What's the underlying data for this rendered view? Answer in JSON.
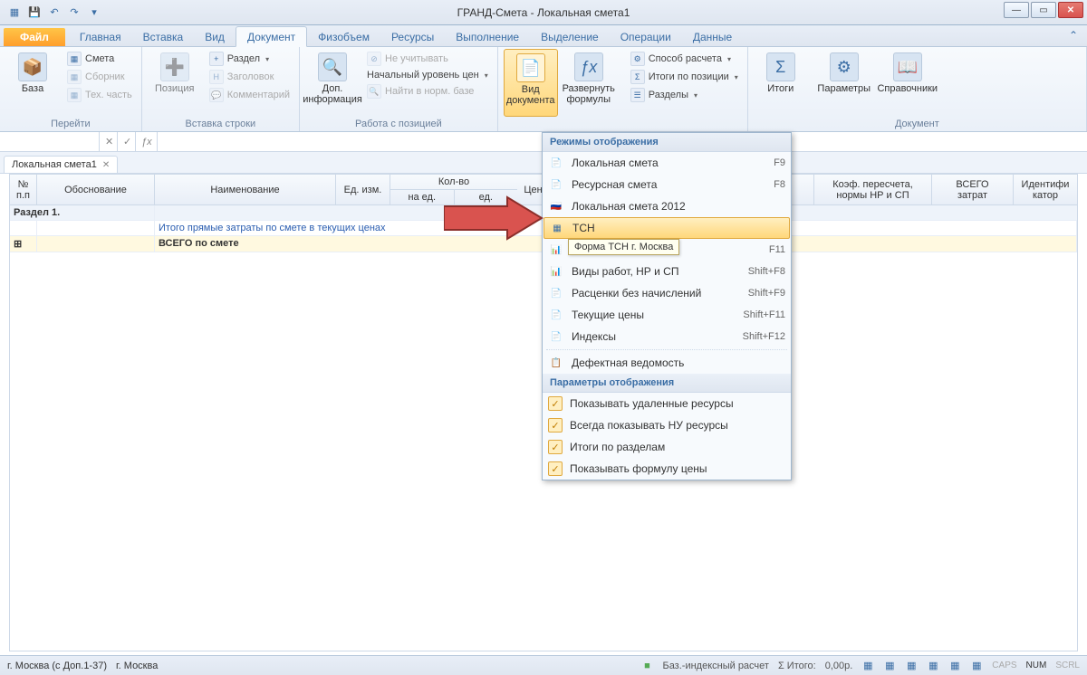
{
  "title": "ГРАНД-Смета - Локальная смета1",
  "qat_icons": [
    "grid-icon",
    "save-icon",
    "undo-icon",
    "redo-icon",
    "dropdown-icon"
  ],
  "tabs": {
    "file": "Файл",
    "items": [
      "Главная",
      "Вставка",
      "Вид",
      "Документ",
      "Физобъем",
      "Ресурсы",
      "Выполнение",
      "Выделение",
      "Операции",
      "Данные"
    ],
    "active": "Документ"
  },
  "ribbon": {
    "g1": {
      "label": "Перейти",
      "big": {
        "label": "База",
        "icon": "📦"
      },
      "items": [
        "Смета",
        "Сборник",
        "Тех. часть"
      ]
    },
    "g2": {
      "label": "Вставка строки",
      "big": {
        "label": "Позиция",
        "icon": "➕"
      },
      "items": [
        "Раздел",
        "Заголовок",
        "Комментарий"
      ]
    },
    "g3": {
      "label": "Работа с позицией",
      "big": {
        "label": "Доп.\nинформация",
        "icon": "🔍"
      },
      "items": [
        "Не учитывать",
        "Начальный уровень цен",
        "Найти в норм. базе"
      ]
    },
    "g4": {
      "big1": {
        "label": "Вид\nдокумента",
        "icon": "📄"
      },
      "big2": {
        "label": "Развернуть\nформулы",
        "icon": "ƒx"
      }
    },
    "g5": {
      "items": [
        "Способ расчета",
        "Итоги по позиции",
        "Разделы"
      ]
    },
    "g6": {
      "label": "Документ",
      "items": [
        {
          "label": "Итоги",
          "icon": "Σ"
        },
        {
          "label": "Параметры",
          "icon": "⚙"
        },
        {
          "label": "Справочники",
          "icon": "📖"
        }
      ]
    }
  },
  "doctab": "Локальная смета1",
  "columns": [
    "№\nп.п",
    "Обоснование",
    "Наименование",
    "Ед. изм.",
    "Кол-во",
    "Цен",
    "Коэф. пересчета,\nнормы НР и СП",
    "ВСЕГО\nзатрат",
    "Идентифи\nкатор"
  ],
  "col_qty_sub": [
    "на ед.",
    "ед."
  ],
  "rows": {
    "section": "Раздел 1.",
    "r1": "Итого прямые затраты по смете в текущих ценах",
    "r2": "ВСЕГО по смете"
  },
  "menu": {
    "hdr1": "Режимы отображения",
    "items1": [
      {
        "label": "Локальная смета",
        "key": "F9",
        "icon": "📄"
      },
      {
        "label": "Ресурсная смета",
        "key": "F8",
        "icon": "📄"
      },
      {
        "label": "Локальная смета 2012",
        "key": "",
        "icon": "🇷🇺"
      },
      {
        "label": "ТСН",
        "key": "",
        "icon": "▦",
        "hl": true
      },
      {
        "label": "Форма ТСН г. Москва",
        "key": "F11",
        "icon": "📊",
        "tooltip": true
      },
      {
        "label": "Виды работ, НР и СП",
        "key": "Shift+F8",
        "icon": "📊"
      },
      {
        "label": "Расценки без начислений",
        "key": "Shift+F9",
        "icon": "📄"
      },
      {
        "label": "Текущие цены",
        "key": "Shift+F11",
        "icon": "📄"
      },
      {
        "label": "Индексы",
        "key": "Shift+F12",
        "icon": "📄"
      },
      {
        "label": "Дефектная ведомость",
        "key": "",
        "icon": "📋",
        "sep": true
      }
    ],
    "hdr2": "Параметры отображения",
    "items2": [
      "Показывать удаленные ресурсы",
      "Всегда показывать НУ ресурсы",
      "Итоги по разделам",
      "Показывать формулу цены"
    ]
  },
  "tooltip": "Форма ТСН г. Москва",
  "status": {
    "left1": "г. Москва (с Доп.1-37)",
    "left2": "г. Москва",
    "calc": "Баз.-индексный расчет",
    "total_lbl": "Σ Итого:",
    "total_val": "0,00р.",
    "inds": [
      "CAPS",
      "NUM",
      "SCRL"
    ]
  }
}
